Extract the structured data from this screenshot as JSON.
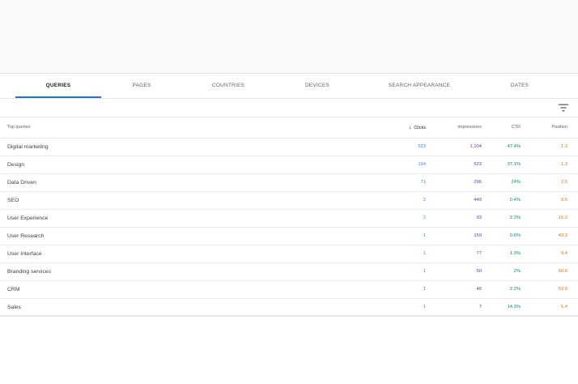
{
  "tabs": [
    {
      "label": "QUERIES",
      "active": true
    },
    {
      "label": "PAGES",
      "active": false
    },
    {
      "label": "COUNTRIES",
      "active": false
    },
    {
      "label": "DEVICES",
      "active": false
    },
    {
      "label": "SEARCH APPEARANCE",
      "active": false
    },
    {
      "label": "DATES",
      "active": false
    }
  ],
  "filter": {
    "icon": "filter-icon"
  },
  "table": {
    "headers": {
      "query": "Top queries",
      "clicks": "Clicks",
      "impressions": "Impressions",
      "ctr": "CTR",
      "position": "Position"
    },
    "sort": {
      "column": "clicks",
      "direction": "descending",
      "icon": "arrow-down-icon"
    },
    "rows": [
      {
        "query": "Digital marketing",
        "clicks": "523",
        "impressions": "1,104",
        "ctr": "47.4%",
        "position": "1.3"
      },
      {
        "query": "Design",
        "clicks": "194",
        "impressions": "523",
        "ctr": "37.1%",
        "position": "1.3"
      },
      {
        "query": "Data Driven",
        "clicks": "71",
        "impressions": "296",
        "ctr": "24%",
        "position": "2.5"
      },
      {
        "query": "SEO",
        "clicks": "2",
        "impressions": "449",
        "ctr": "0.4%",
        "position": "9.5"
      },
      {
        "query": "User Experience",
        "clicks": "2",
        "impressions": "93",
        "ctr": "2.2%",
        "position": "15.2"
      },
      {
        "query": "User Research",
        "clicks": "1",
        "impressions": "159",
        "ctr": "0.6%",
        "position": "43.3"
      },
      {
        "query": "User Interface",
        "clicks": "1",
        "impressions": "77",
        "ctr": "1.3%",
        "position": "9.4"
      },
      {
        "query": "Branding services",
        "clicks": "1",
        "impressions": "50",
        "ctr": "2%",
        "position": "50.6"
      },
      {
        "query": "CRM",
        "clicks": "1",
        "impressions": "46",
        "ctr": "2.2%",
        "position": "53.9"
      },
      {
        "query": "Sales",
        "clicks": "1",
        "impressions": "7",
        "ctr": "14.3%",
        "position": "5.4"
      }
    ]
  },
  "colors": {
    "active_tab_indicator": "#1a73e8",
    "clicks": "#4285f4",
    "impressions": "#5e35b1",
    "ctr": "#00897b",
    "position": "#e8710a"
  }
}
